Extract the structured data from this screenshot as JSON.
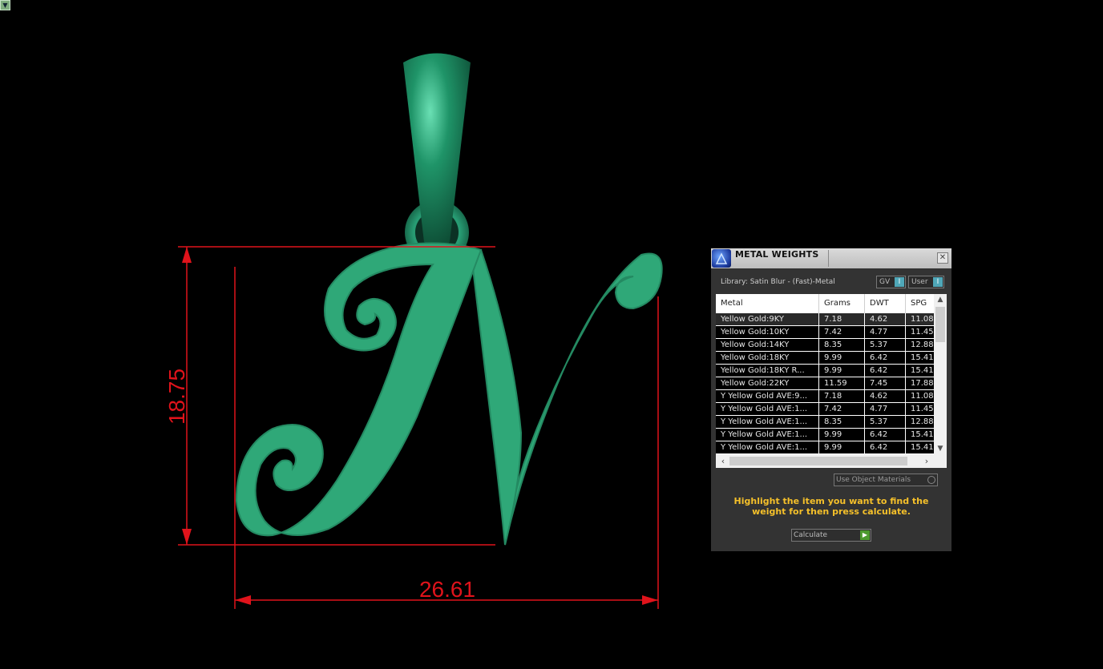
{
  "viewport": {
    "menu_icon": "triangle-down-icon"
  },
  "dimensions": {
    "height_label": "18.75",
    "width_label": "26.61",
    "dimension_color": "#e0131b",
    "model_color": "#2fa878"
  },
  "panel": {
    "title": "METAL WEIGHTS",
    "library": "Library: Satin Blur - (Fast)-Metal",
    "toggle_gv": "GV",
    "toggle_user": "User",
    "toggle_knob": "I",
    "columns": [
      "Metal",
      "Grams",
      "DWT",
      "SPG"
    ],
    "rows": [
      {
        "metal": "Yellow Gold:9KY",
        "grams": "7.18",
        "dwt": "4.62",
        "spg": "11.08"
      },
      {
        "metal": "Yellow Gold:10KY",
        "grams": "7.42",
        "dwt": "4.77",
        "spg": "11.45"
      },
      {
        "metal": "Yellow Gold:14KY",
        "grams": "8.35",
        "dwt": "5.37",
        "spg": "12.88"
      },
      {
        "metal": "Yellow Gold:18KY",
        "grams": "9.99",
        "dwt": "6.42",
        "spg": "15.41"
      },
      {
        "metal": "Yellow Gold:18KY R...",
        "grams": "9.99",
        "dwt": "6.42",
        "spg": "15.41"
      },
      {
        "metal": "Yellow Gold:22KY",
        "grams": "11.59",
        "dwt": "7.45",
        "spg": "17.88"
      },
      {
        "metal": "Y Yellow Gold AVE:9...",
        "grams": "7.18",
        "dwt": "4.62",
        "spg": "11.08"
      },
      {
        "metal": "Y Yellow Gold AVE:1...",
        "grams": "7.42",
        "dwt": "4.77",
        "spg": "11.45"
      },
      {
        "metal": "Y Yellow Gold AVE:1...",
        "grams": "8.35",
        "dwt": "5.37",
        "spg": "12.88"
      },
      {
        "metal": "Y Yellow Gold AVE:1...",
        "grams": "9.99",
        "dwt": "6.42",
        "spg": "15.41"
      },
      {
        "metal": "Y Yellow Gold AVE:1...",
        "grams": "9.99",
        "dwt": "6.42",
        "spg": "15.41"
      }
    ],
    "use_object_materials": "Use Object Materials",
    "hint": "Highlight the item you want to find the weight for then press calculate.",
    "calculate_label": "Calculate",
    "hint_color": "#f5c02a"
  }
}
